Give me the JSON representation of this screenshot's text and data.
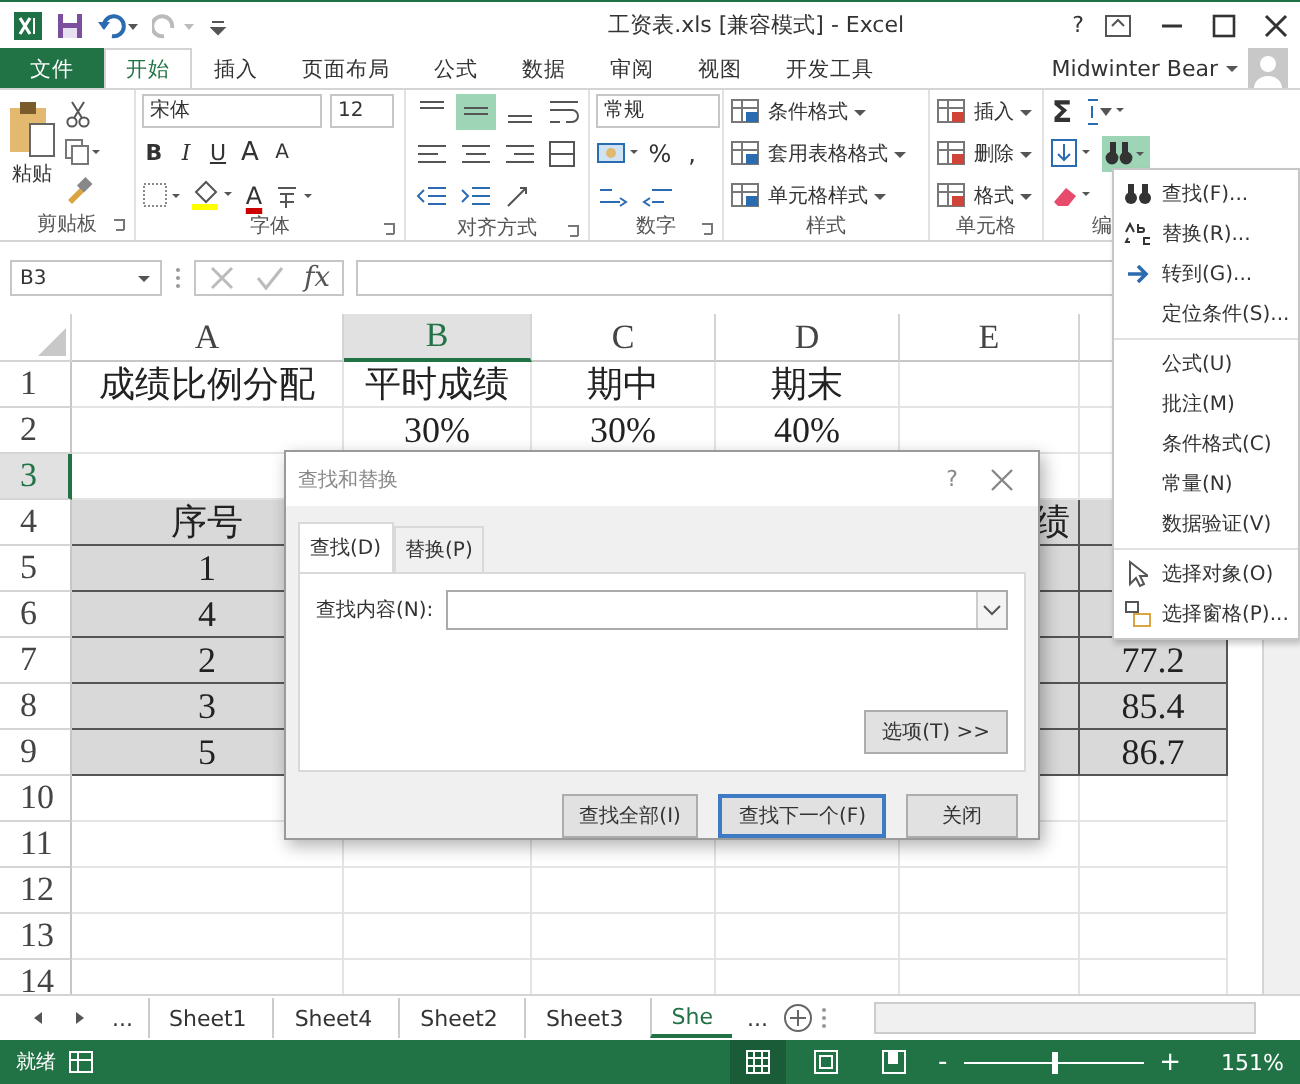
{
  "window": {
    "title": "工资表.xls  [兼容模式] - Excel",
    "help": "?"
  },
  "ribbon_tabs": [
    {
      "label": "文件",
      "kind": "file",
      "selected": false
    },
    {
      "label": "开始",
      "kind": "tab",
      "selected": true
    },
    {
      "label": "插入",
      "kind": "tab",
      "selected": false
    },
    {
      "label": "页面布局",
      "kind": "tab",
      "selected": false
    },
    {
      "label": "公式",
      "kind": "tab",
      "selected": false
    },
    {
      "label": "数据",
      "kind": "tab",
      "selected": false
    },
    {
      "label": "审阅",
      "kind": "tab",
      "selected": false
    },
    {
      "label": "视图",
      "kind": "tab",
      "selected": false
    },
    {
      "label": "开发工具",
      "kind": "tab",
      "selected": false
    }
  ],
  "user": {
    "name": "Midwinter Bear"
  },
  "ribbon": {
    "groups": [
      {
        "kind": "clipboard",
        "label": "剪贴板",
        "paste_label": "粘贴"
      },
      {
        "kind": "font",
        "label": "字体",
        "font_name": "宋体",
        "font_size": "12",
        "style_buttons": [
          "B",
          "I",
          "U"
        ],
        "size_buttons": [
          "A",
          "A"
        ],
        "font_color_label": "A"
      },
      {
        "kind": "alignment",
        "label": "对齐方式",
        "align_buttons": [
          {
            "selected": false
          },
          {
            "selected": true
          },
          {
            "selected": false
          }
        ]
      },
      {
        "kind": "number",
        "label": "数字",
        "format": "常规",
        "symbols": [
          "%",
          ","
        ]
      },
      {
        "kind": "styles",
        "label": "样式",
        "buttons": [
          "条件格式",
          "套用表格格式",
          "单元格样式"
        ]
      },
      {
        "kind": "cells",
        "label": "单元格",
        "buttons": [
          "插入",
          "删除",
          "格式"
        ]
      },
      {
        "kind": "editing",
        "label": "编",
        "sum_label": "Σ",
        "find_pressed": true
      }
    ]
  },
  "formula_bar": {
    "name_box": "B3",
    "fx": "fx"
  },
  "sheet": {
    "columns": [
      {
        "label": "A",
        "selected": false
      },
      {
        "label": "B",
        "selected": true
      },
      {
        "label": "C",
        "selected": false
      },
      {
        "label": "D",
        "selected": false
      },
      {
        "label": "E",
        "selected": false
      }
    ],
    "rows": [
      {
        "number": "1",
        "selected": false,
        "shaded": false,
        "cells": {
          "A": "成绩比例分配",
          "B": "平时成绩",
          "C": "期中",
          "D": "期末"
        }
      },
      {
        "number": "2",
        "selected": false,
        "shaded": false,
        "cells": {
          "B": "30%",
          "C": "30%",
          "D": "40%"
        }
      },
      {
        "number": "3",
        "selected": true,
        "shaded": false,
        "cells": {}
      },
      {
        "number": "4",
        "selected": false,
        "shaded": true,
        "cells": {
          "A": "序号",
          "E": "绩"
        }
      },
      {
        "number": "5",
        "selected": false,
        "shaded": true,
        "cells": {
          "A": "1"
        }
      },
      {
        "number": "6",
        "selected": false,
        "shaded": true,
        "cells": {
          "A": "4"
        }
      },
      {
        "number": "7",
        "selected": false,
        "shaded": true,
        "cells": {
          "A": "2",
          "column_6": "77.2"
        }
      },
      {
        "number": "8",
        "selected": false,
        "shaded": true,
        "cells": {
          "A": "3",
          "column_6": "85.4"
        }
      },
      {
        "number": "9",
        "selected": false,
        "shaded": true,
        "cells": {
          "A": "5",
          "column_6": "86.7"
        }
      },
      {
        "number": "10",
        "selected": false,
        "shaded": false,
        "cells": {}
      },
      {
        "number": "11",
        "selected": false,
        "shaded": false,
        "cells": {}
      },
      {
        "number": "12",
        "selected": false,
        "shaded": false,
        "cells": {}
      },
      {
        "number": "13",
        "selected": false,
        "shaded": false,
        "cells": {}
      },
      {
        "number": "14",
        "selected": false,
        "shaded": false,
        "cells": {}
      }
    ]
  },
  "edit_menu": {
    "items": [
      {
        "label": "查找(F)...",
        "kind": "find",
        "divider_above": false
      },
      {
        "label": "替换(R)...",
        "kind": "replace",
        "divider_above": false
      },
      {
        "label": "转到(G)...",
        "kind": "goto",
        "divider_above": false
      },
      {
        "label": "定位条件(S)...",
        "kind": "plain",
        "divider_above": false
      },
      {
        "label": "公式(U)",
        "kind": "plain",
        "divider_above": true
      },
      {
        "label": "批注(M)",
        "kind": "plain",
        "divider_above": false
      },
      {
        "label": "条件格式(C)",
        "kind": "plain",
        "divider_above": false
      },
      {
        "label": "常量(N)",
        "kind": "plain",
        "divider_above": false
      },
      {
        "label": "数据验证(V)",
        "kind": "plain",
        "divider_above": false
      },
      {
        "label": "选择对象(O)",
        "kind": "select",
        "divider_above": true
      },
      {
        "label": "选择窗格(P)...",
        "kind": "pane",
        "divider_above": false
      }
    ]
  },
  "dialog": {
    "title": "查找和替换",
    "help": "?",
    "tabs": [
      {
        "label": "查找(D)",
        "selected": true
      },
      {
        "label": "替换(P)",
        "selected": false
      }
    ],
    "field_label": "查找内容(N):",
    "options_button": "选项(T) >>",
    "buttons": [
      {
        "label": "查找全部(I)",
        "default": false
      },
      {
        "label": "查找下一个(F)",
        "default": true
      },
      {
        "label": "关闭",
        "default": false
      }
    ]
  },
  "sheet_tabs": {
    "more_left": "...",
    "tabs": [
      {
        "label": "Sheet1",
        "selected": false
      },
      {
        "label": "Sheet4",
        "selected": false
      },
      {
        "label": "Sheet2",
        "selected": false
      },
      {
        "label": "Sheet3",
        "selected": false
      },
      {
        "label": "She",
        "selected": true
      }
    ],
    "more_right": "..."
  },
  "status_bar": {
    "status": "就绪",
    "views": [
      {
        "selected": true
      },
      {
        "selected": false
      },
      {
        "selected": false
      }
    ],
    "zoom_out": "-",
    "zoom_in": "+",
    "zoom": {
      "level": 0.5
    },
    "zoom_text": "151%"
  }
}
